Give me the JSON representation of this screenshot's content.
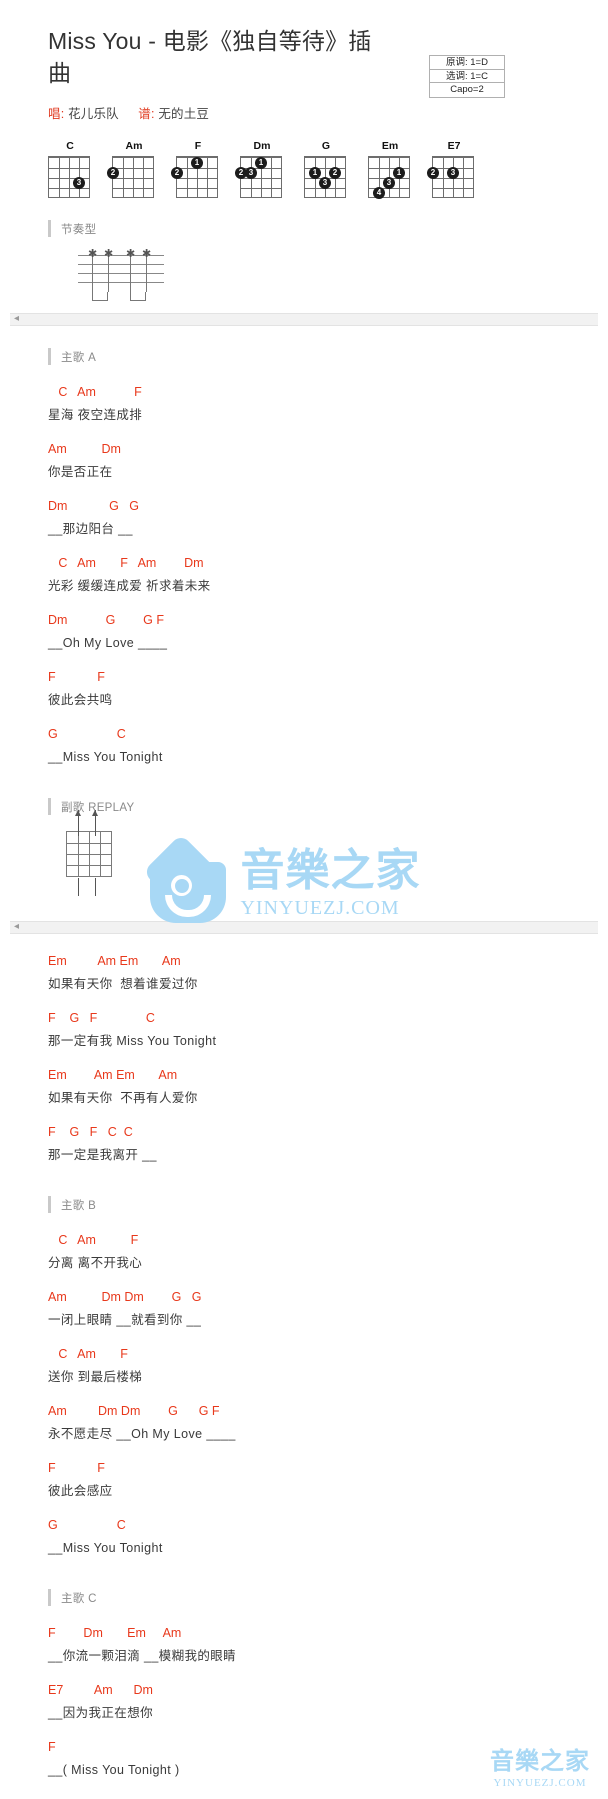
{
  "header": {
    "title": "Miss You - 电影《独自等待》插曲",
    "singer_tag": "唱:",
    "singer": "花儿乐队",
    "arranger_tag": "谱:",
    "arranger": "无的土豆"
  },
  "keybox": {
    "rows": [
      "原调: 1=D",
      "选调: 1=C",
      "Capo=2"
    ]
  },
  "chords": [
    {
      "name": "C",
      "dots": [
        {
          "s": 1,
          "f": 3,
          "n": "3"
        }
      ]
    },
    {
      "name": "Am",
      "dots": [
        {
          "s": 4,
          "f": 2,
          "n": "2"
        }
      ]
    },
    {
      "name": "F",
      "dots": [
        {
          "s": 4,
          "f": 2,
          "n": "2"
        },
        {
          "s": 2,
          "f": 1,
          "n": "1"
        }
      ]
    },
    {
      "name": "Dm",
      "dots": [
        {
          "s": 4,
          "f": 2,
          "n": "2"
        },
        {
          "s": 3,
          "f": 2,
          "n": "3"
        },
        {
          "s": 2,
          "f": 1,
          "n": "1"
        }
      ]
    },
    {
      "name": "G",
      "dots": [
        {
          "s": 3,
          "f": 2,
          "n": "1"
        },
        {
          "s": 1,
          "f": 2,
          "n": "2"
        },
        {
          "s": 2,
          "f": 3,
          "n": "3"
        }
      ]
    },
    {
      "name": "Em",
      "dots": [
        {
          "s": 1,
          "f": 2,
          "n": "1"
        },
        {
          "s": 2,
          "f": 3,
          "n": "3"
        },
        {
          "s": 3,
          "f": 4,
          "n": "4"
        }
      ]
    },
    {
      "name": "E7",
      "dots": [
        {
          "s": 4,
          "f": 2,
          "n": "2"
        },
        {
          "s": 2,
          "f": 2,
          "n": "3"
        }
      ]
    }
  ],
  "sections": {
    "rhythm": "节奏型",
    "verse_a": "主歌 A",
    "chorus": "副歌 REPLAY",
    "verse_b": "主歌 B",
    "verse_c": "主歌 C"
  },
  "verse_a": [
    {
      "chords": "   C   Am           F",
      "lyric": "星海 夜空连成排"
    },
    {
      "chords": "Am          Dm",
      "lyric": "你是否正在"
    },
    {
      "chords": "Dm            G   G",
      "lyric": "__那边阳台 __"
    },
    {
      "chords": "   C   Am       F   Am        Dm",
      "lyric": "光彩 缓缓连成爱 祈求着未来"
    },
    {
      "chords": "Dm           G        G F",
      "lyric": "__Oh My Love ____"
    },
    {
      "chords": "F            F",
      "lyric": "彼此会共鸣"
    },
    {
      "chords": "G                 C",
      "lyric": "__Miss You Tonight"
    }
  ],
  "chorus": [
    {
      "chords": "Em         Am Em       Am",
      "lyric": "如果有天你  想着谁爱过你"
    },
    {
      "chords": "F    G   F              C",
      "lyric": "那一定有我 Miss You Tonight"
    },
    {
      "chords": "Em        Am Em       Am",
      "lyric": "如果有天你  不再有人爱你"
    },
    {
      "chords": "F    G   F   C  C",
      "lyric": "那一定是我离开 __"
    }
  ],
  "verse_b": [
    {
      "chords": "   C   Am          F",
      "lyric": "分离 离不开我心"
    },
    {
      "chords": "Am          Dm Dm        G   G",
      "lyric": "一闭上眼睛 __就看到你 __"
    },
    {
      "chords": "   C   Am       F",
      "lyric": "送你 到最后楼梯"
    },
    {
      "chords": "Am         Dm Dm        G      G F",
      "lyric": "永不愿走尽 __Oh My Love ____"
    },
    {
      "chords": "F            F",
      "lyric": "彼此会感应"
    },
    {
      "chords": "G                 C",
      "lyric": "__Miss You Tonight"
    }
  ],
  "verse_c": [
    {
      "chords": "F        Dm       Em     Am",
      "lyric": "__你流一颗泪滴 __模糊我的眼睛"
    },
    {
      "chords": "E7         Am      Dm",
      "lyric": "__因为我正在想你"
    },
    {
      "chords": "F",
      "lyric": "__( Miss You Tonight )"
    }
  ],
  "watermark": {
    "cn": "音樂之家",
    "en": "YINYUEZJ.COM"
  }
}
